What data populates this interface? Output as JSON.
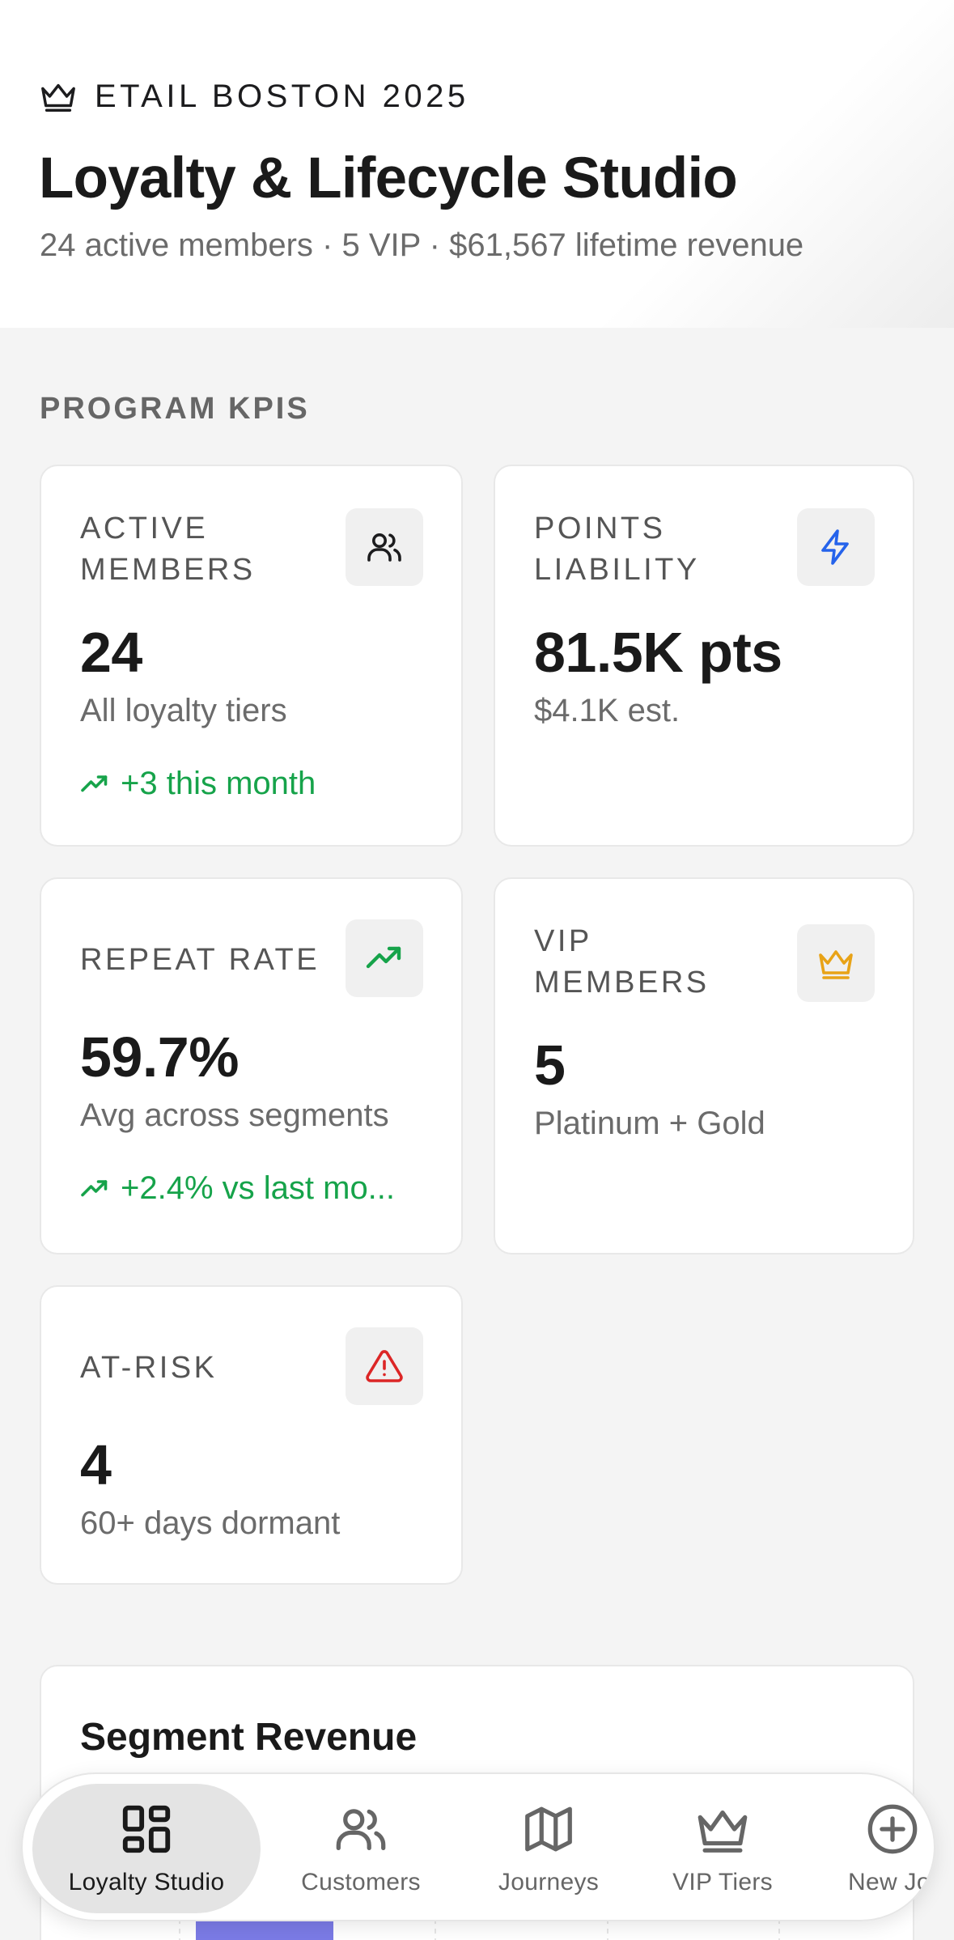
{
  "header": {
    "eyebrow": "ETAIL BOSTON 2025",
    "eyebrow_icon": "crown-icon",
    "title": "Loyalty & Lifecycle Studio",
    "subtitle": "24 active members · 5 VIP · $61,567 lifetime revenue"
  },
  "kpis": {
    "section_label": "PROGRAM KPIS",
    "active_members": {
      "label_line1": "ACTIVE",
      "label_line2": "MEMBERS",
      "icon": "users-icon",
      "value": "24",
      "sub": "All loyalty tiers",
      "trend": "+3 this month"
    },
    "points_liability": {
      "label_line1": "POINTS",
      "label_line2": "LIABILITY",
      "icon": "zap-icon",
      "value": "81.5K pts",
      "sub": "$4.1K est."
    },
    "repeat_rate": {
      "label": "REPEAT RATE",
      "icon": "trending-up-icon",
      "value": "59.7%",
      "sub": "Avg across segments",
      "trend": "+2.4% vs last mo..."
    },
    "vip_members": {
      "label_line1": "VIP",
      "label_line2": "MEMBERS",
      "icon": "crown-icon",
      "value": "5",
      "sub": "Platinum + Gold"
    },
    "at_risk": {
      "label": "AT-RISK",
      "icon": "alert-triangle-icon",
      "value": "4",
      "sub": "60+ days dormant"
    }
  },
  "segment_revenue": {
    "title": "Segment Revenue"
  },
  "nav": {
    "items": [
      {
        "label": "Loyalty Studio",
        "icon": "dashboard-icon",
        "active": true
      },
      {
        "label": "Customers",
        "icon": "users-icon",
        "active": false
      },
      {
        "label": "Journeys",
        "icon": "map-icon",
        "active": false
      },
      {
        "label": "VIP Tiers",
        "icon": "crown-icon",
        "active": false
      },
      {
        "label": "New Jo",
        "icon": "plus-circle-icon",
        "active": false
      }
    ]
  },
  "colors": {
    "trend_green": "#16a34a",
    "zap_blue": "#2563eb",
    "crown_amber": "#e8a317",
    "alert_red": "#dc2626",
    "chart_bar": "#7b7be6"
  }
}
